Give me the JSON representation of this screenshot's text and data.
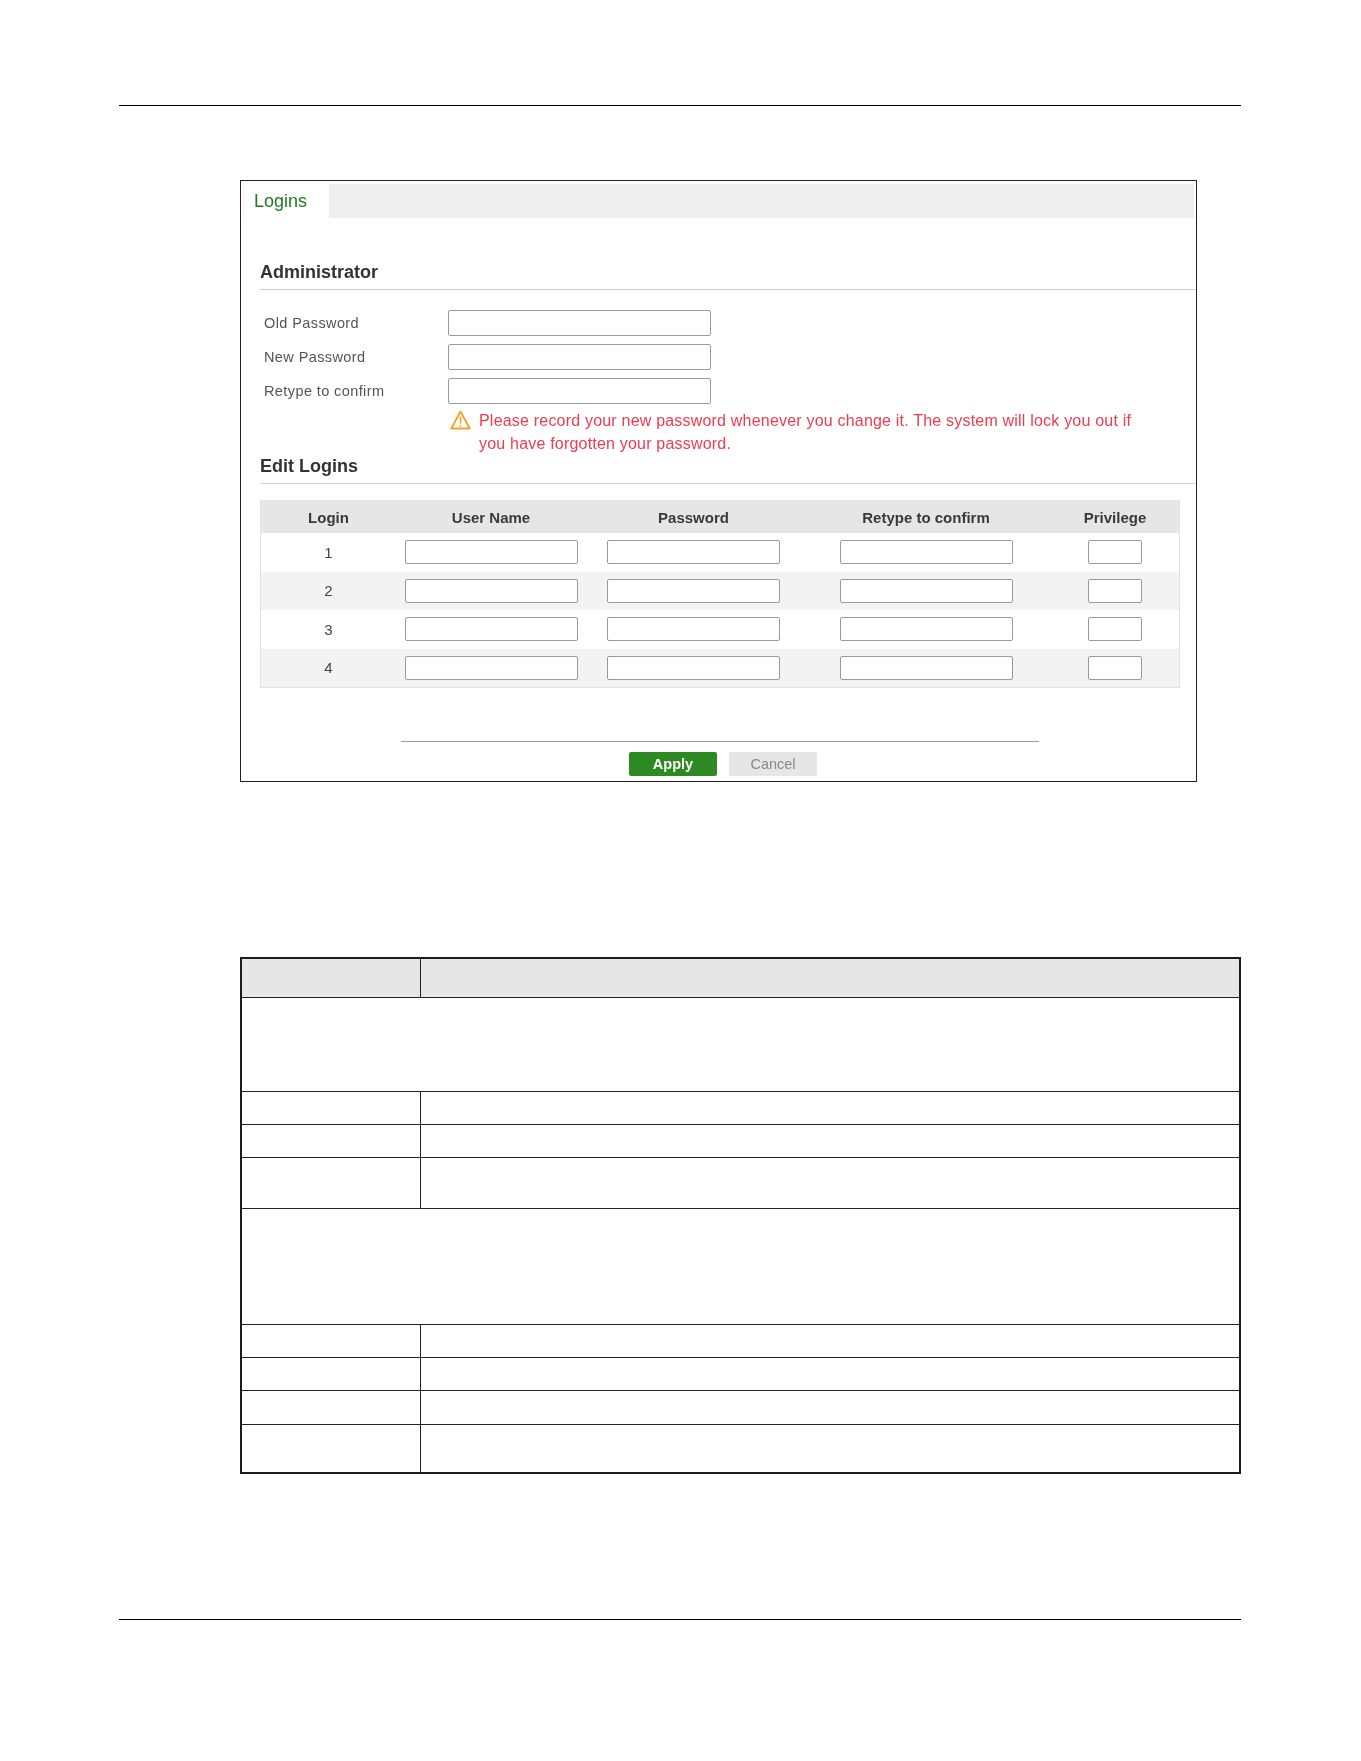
{
  "panel": {
    "tabs": [
      {
        "label": "Logins",
        "selected": true
      }
    ],
    "administrator": {
      "heading": "Administrator",
      "fields": [
        {
          "label": "Old Password"
        },
        {
          "label": "New Password"
        },
        {
          "label": "Retype to confirm"
        }
      ],
      "warning": "Please record your new password whenever you change it. The system will lock you out if you have forgotten your password."
    },
    "edit_logins": {
      "heading": "Edit Logins",
      "columns": [
        "Login",
        "User Name",
        "Password",
        "Retype to confirm",
        "Privilege"
      ],
      "rows": [
        {
          "login": "1"
        },
        {
          "login": "2"
        },
        {
          "login": "3"
        },
        {
          "login": "4"
        }
      ]
    },
    "buttons": [
      {
        "label": "Apply",
        "kind": "primary"
      },
      {
        "label": "Cancel",
        "kind": "secondary"
      }
    ]
  },
  "description_table": {
    "rows": [
      {
        "kind": "header"
      },
      {
        "kind": "span"
      },
      {
        "kind": "pair"
      },
      {
        "kind": "pair"
      },
      {
        "kind": "pair"
      },
      {
        "kind": "span"
      },
      {
        "kind": "pair"
      },
      {
        "kind": "pair"
      },
      {
        "kind": "pair"
      },
      {
        "kind": "pair"
      }
    ]
  }
}
